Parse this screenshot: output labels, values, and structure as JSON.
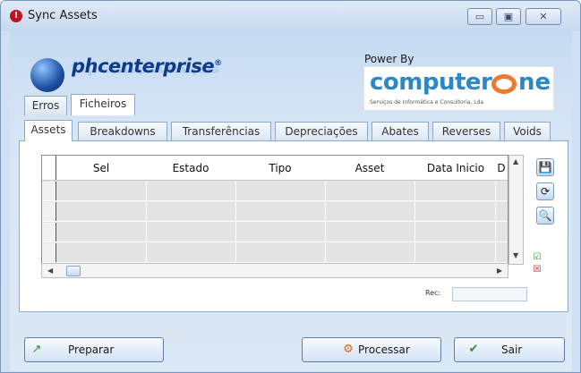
{
  "window": {
    "title": "Sync Assets",
    "controls": {
      "minimize": "▭",
      "maximize": "▣",
      "close": "✕"
    }
  },
  "branding": {
    "logo_text": "phcenterprise",
    "logo_mark": "®",
    "power_by": "Power By",
    "partner_logo": "computer one",
    "partner_tagline": "Serviços de Informática e Consultoria, Lda"
  },
  "top_tabs": [
    "Erros",
    "Ficheiros"
  ],
  "main_tabs": [
    {
      "label": "Assets",
      "active": true
    },
    {
      "label": "Breakdowns"
    },
    {
      "label": "Transferências"
    },
    {
      "label": "Depreciações"
    },
    {
      "label": "Abates"
    },
    {
      "label": "Reverses"
    },
    {
      "label": "Voids"
    }
  ],
  "grid": {
    "columns": [
      "Sel",
      "Estado",
      "Tipo",
      "Asset",
      "Data Inicio",
      "D"
    ],
    "row_count": 4
  },
  "record": {
    "label": "Rec:",
    "value": ""
  },
  "buttons": {
    "prepare": "Preparar",
    "process": "Processar",
    "exit": "Sair"
  },
  "colors": {
    "accent": "#2b87c7",
    "brand_orange": "#ee7a2e",
    "window_bg": "#cfe0f3"
  }
}
